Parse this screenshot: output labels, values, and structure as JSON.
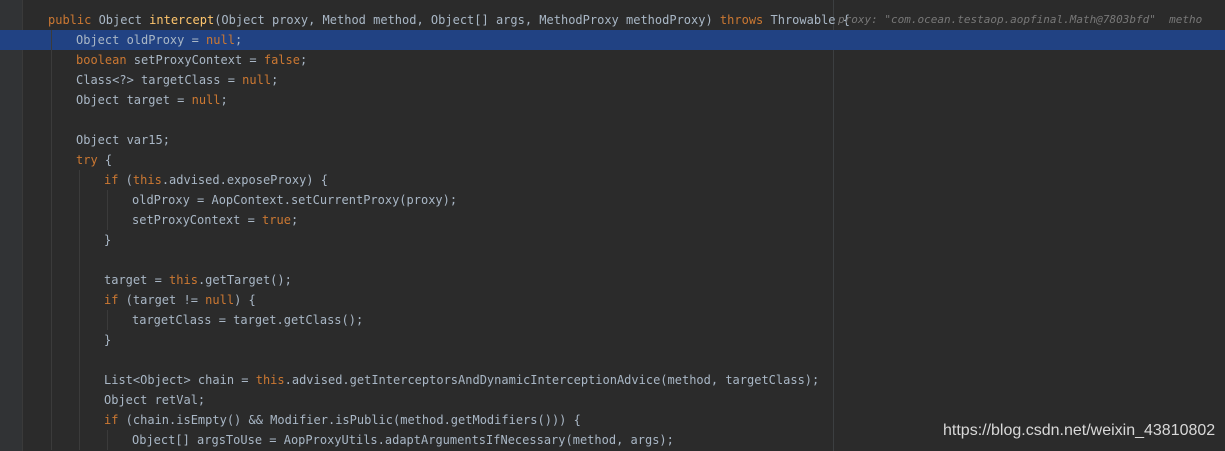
{
  "editor": {
    "inline_hint": "proxy: \"com.ocean.testaop.aopfinal.Math@7803bfd\"  metho",
    "watermark": "https://blog.csdn.net/weixin_43810802",
    "colors": {
      "background": "#2b2b2b",
      "current_line": "#214283",
      "keyword": "#cc7832",
      "default_text": "#a9b7c6",
      "hint": "#787878"
    },
    "lines": [
      {
        "indent": 1,
        "tokens": [
          {
            "t": "public",
            "k": "kw"
          },
          {
            "t": " Object "
          },
          {
            "t": "intercept",
            "k": "fn"
          },
          {
            "t": "(Object proxy, Method method, Object[] args, MethodProxy methodProxy) "
          },
          {
            "t": "throws",
            "k": "kw"
          },
          {
            "t": " Throwable {"
          }
        ]
      },
      {
        "indent": 2,
        "current": true,
        "tokens": [
          {
            "t": "Object oldProxy = "
          },
          {
            "t": "null",
            "k": "kw"
          },
          {
            "t": ";"
          }
        ]
      },
      {
        "indent": 2,
        "tokens": [
          {
            "t": "boolean",
            "k": "kw"
          },
          {
            "t": " setProxyContext = "
          },
          {
            "t": "false",
            "k": "kw"
          },
          {
            "t": ";"
          }
        ]
      },
      {
        "indent": 2,
        "tokens": [
          {
            "t": "Class<?> targetClass = "
          },
          {
            "t": "null",
            "k": "kw"
          },
          {
            "t": ";"
          }
        ]
      },
      {
        "indent": 2,
        "tokens": [
          {
            "t": "Object target = "
          },
          {
            "t": "null",
            "k": "kw"
          },
          {
            "t": ";"
          }
        ]
      },
      {
        "indent": 2,
        "tokens": []
      },
      {
        "indent": 2,
        "tokens": [
          {
            "t": "Object var15;"
          }
        ]
      },
      {
        "indent": 2,
        "tokens": [
          {
            "t": "try",
            "k": "kw"
          },
          {
            "t": " {"
          }
        ]
      },
      {
        "indent": 3,
        "tokens": [
          {
            "t": "if",
            "k": "kw"
          },
          {
            "t": " ("
          },
          {
            "t": "this",
            "k": "kw"
          },
          {
            "t": ".advised.exposeProxy) {"
          }
        ]
      },
      {
        "indent": 4,
        "tokens": [
          {
            "t": "oldProxy = AopContext.setCurrentProxy(proxy);"
          }
        ]
      },
      {
        "indent": 4,
        "tokens": [
          {
            "t": "setProxyContext = "
          },
          {
            "t": "true",
            "k": "kw"
          },
          {
            "t": ";"
          }
        ]
      },
      {
        "indent": 3,
        "tokens": [
          {
            "t": "}"
          }
        ]
      },
      {
        "indent": 3,
        "tokens": []
      },
      {
        "indent": 3,
        "tokens": [
          {
            "t": "target = "
          },
          {
            "t": "this",
            "k": "kw"
          },
          {
            "t": ".getTarget();"
          }
        ]
      },
      {
        "indent": 3,
        "tokens": [
          {
            "t": "if",
            "k": "kw"
          },
          {
            "t": " (target != "
          },
          {
            "t": "null",
            "k": "kw"
          },
          {
            "t": ") {"
          }
        ]
      },
      {
        "indent": 4,
        "tokens": [
          {
            "t": "targetClass = target.getClass();"
          }
        ]
      },
      {
        "indent": 3,
        "tokens": [
          {
            "t": "}"
          }
        ]
      },
      {
        "indent": 3,
        "tokens": []
      },
      {
        "indent": 3,
        "tokens": [
          {
            "t": "List<Object> chain = "
          },
          {
            "t": "this",
            "k": "kw"
          },
          {
            "t": ".advised.getInterceptorsAndDynamicInterceptionAdvice(method, targetClass);"
          }
        ]
      },
      {
        "indent": 3,
        "tokens": [
          {
            "t": "Object retVal;"
          }
        ]
      },
      {
        "indent": 3,
        "tokens": [
          {
            "t": "if",
            "k": "kw"
          },
          {
            "t": " (chain.isEmpty() && Modifier."
          },
          {
            "t": "isPublic"
          },
          {
            "t": "(method.getModifiers())) {"
          }
        ]
      },
      {
        "indent": 4,
        "tokens": [
          {
            "t": "Object[] argsToUse = AopProxyUtils."
          },
          {
            "t": "adaptArgumentsIfNecessary"
          },
          {
            "t": "(method, args);"
          }
        ]
      }
    ]
  }
}
